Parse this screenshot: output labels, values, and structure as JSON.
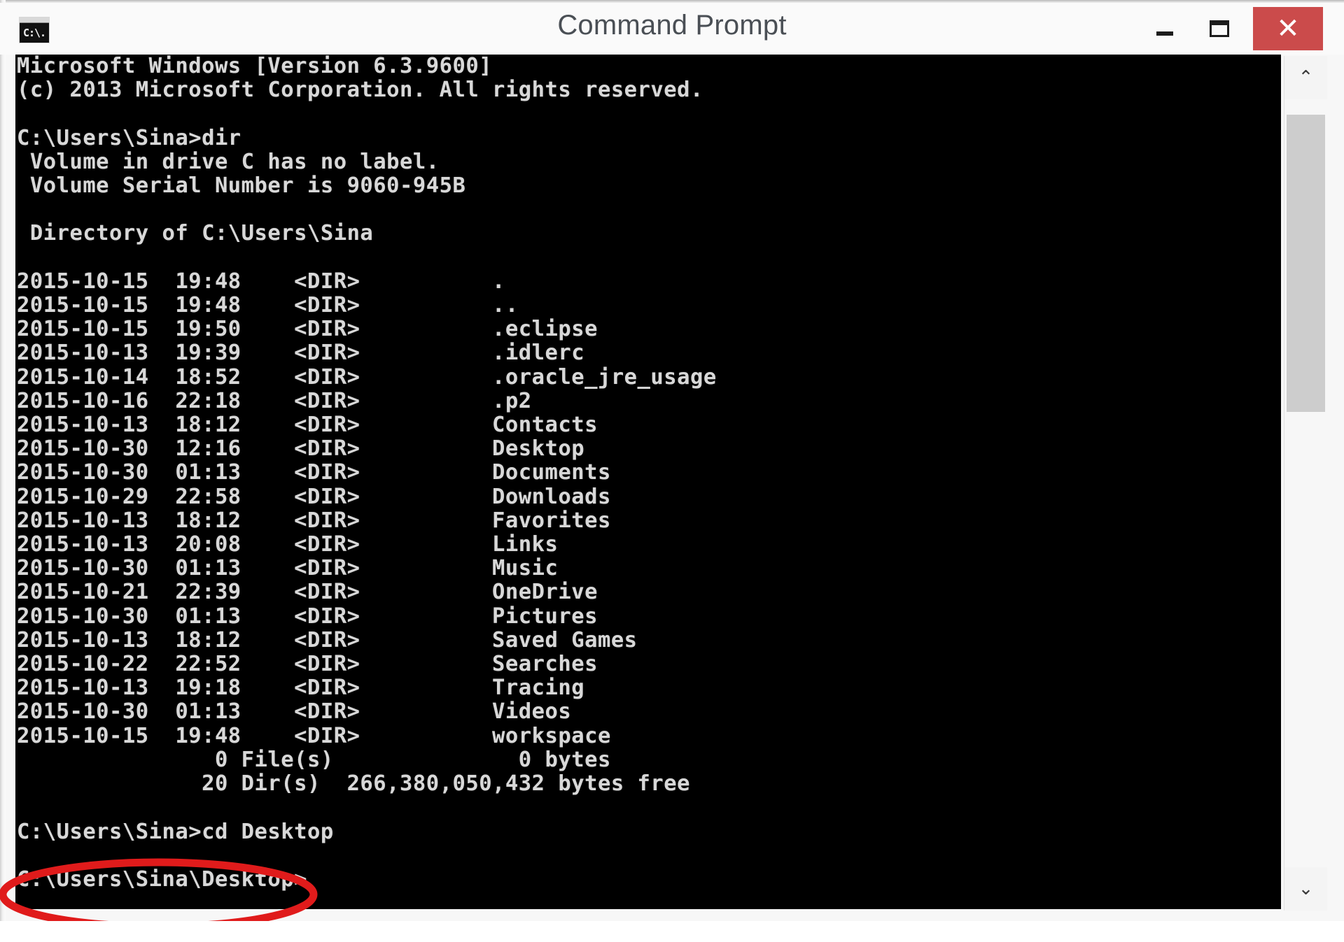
{
  "window": {
    "title": "Command Prompt",
    "app_icon_label": "C:\\.",
    "icon_name": "command-prompt-icon",
    "controls": {
      "minimize_label": "–",
      "maximize_label": "☐",
      "close_label": "✕"
    },
    "close_button_color": "#cb4b4b",
    "titlebar_background": "#fafafa"
  },
  "console": {
    "background": "#000000",
    "foreground": "#d8d8d8",
    "banner": [
      "Microsoft Windows [Version 6.3.9600]",
      "(c) 2013 Microsoft Corporation. All rights reserved."
    ],
    "prompt_dir": "C:\\Users\\Sina>",
    "command_1": "dir",
    "volume_lines": [
      " Volume in drive C has no label.",
      " Volume Serial Number is 9060-945B"
    ],
    "directory_header": " Directory of C:\\Users\\Sina",
    "listing_columns": [
      "date",
      "time",
      "type",
      "name"
    ],
    "listing": [
      {
        "date": "2015-10-15",
        "time": "19:48",
        "type": "<DIR>",
        "name": "."
      },
      {
        "date": "2015-10-15",
        "time": "19:48",
        "type": "<DIR>",
        "name": ".."
      },
      {
        "date": "2015-10-15",
        "time": "19:50",
        "type": "<DIR>",
        "name": ".eclipse"
      },
      {
        "date": "2015-10-13",
        "time": "19:39",
        "type": "<DIR>",
        "name": ".idlerc"
      },
      {
        "date": "2015-10-14",
        "time": "18:52",
        "type": "<DIR>",
        "name": ".oracle_jre_usage"
      },
      {
        "date": "2015-10-16",
        "time": "22:18",
        "type": "<DIR>",
        "name": ".p2"
      },
      {
        "date": "2015-10-13",
        "time": "18:12",
        "type": "<DIR>",
        "name": "Contacts"
      },
      {
        "date": "2015-10-30",
        "time": "12:16",
        "type": "<DIR>",
        "name": "Desktop"
      },
      {
        "date": "2015-10-30",
        "time": "01:13",
        "type": "<DIR>",
        "name": "Documents"
      },
      {
        "date": "2015-10-29",
        "time": "22:58",
        "type": "<DIR>",
        "name": "Downloads"
      },
      {
        "date": "2015-10-13",
        "time": "18:12",
        "type": "<DIR>",
        "name": "Favorites"
      },
      {
        "date": "2015-10-13",
        "time": "20:08",
        "type": "<DIR>",
        "name": "Links"
      },
      {
        "date": "2015-10-30",
        "time": "01:13",
        "type": "<DIR>",
        "name": "Music"
      },
      {
        "date": "2015-10-21",
        "time": "22:39",
        "type": "<DIR>",
        "name": "OneDrive"
      },
      {
        "date": "2015-10-30",
        "time": "01:13",
        "type": "<DIR>",
        "name": "Pictures"
      },
      {
        "date": "2015-10-13",
        "time": "18:12",
        "type": "<DIR>",
        "name": "Saved Games"
      },
      {
        "date": "2015-10-22",
        "time": "22:52",
        "type": "<DIR>",
        "name": "Searches"
      },
      {
        "date": "2015-10-13",
        "time": "19:18",
        "type": "<DIR>",
        "name": "Tracing"
      },
      {
        "date": "2015-10-30",
        "time": "01:13",
        "type": "<DIR>",
        "name": "Videos"
      },
      {
        "date": "2015-10-15",
        "time": "19:48",
        "type": "<DIR>",
        "name": "workspace"
      }
    ],
    "summary": {
      "file_count": "0",
      "file_label": "File(s)",
      "file_bytes": "0 bytes",
      "dir_count": "20",
      "dir_label": "Dir(s)",
      "free_bytes": "266,380,050,432 bytes free"
    },
    "command_2_prompt": "C:\\Users\\Sina>",
    "command_2": "cd Desktop",
    "final_prompt": "C:\\Users\\Sina\\Desktop>",
    "full_text": "Microsoft Windows [Version 6.3.9600]\n(c) 2013 Microsoft Corporation. All rights reserved.\n\nC:\\Users\\Sina>dir\n Volume in drive C has no label.\n Volume Serial Number is 9060-945B\n\n Directory of C:\\Users\\Sina\n\n2015-10-15  19:48    <DIR>          .\n2015-10-15  19:48    <DIR>          ..\n2015-10-15  19:50    <DIR>          .eclipse\n2015-10-13  19:39    <DIR>          .idlerc\n2015-10-14  18:52    <DIR>          .oracle_jre_usage\n2015-10-16  22:18    <DIR>          .p2\n2015-10-13  18:12    <DIR>          Contacts\n2015-10-30  12:16    <DIR>          Desktop\n2015-10-30  01:13    <DIR>          Documents\n2015-10-29  22:58    <DIR>          Downloads\n2015-10-13  18:12    <DIR>          Favorites\n2015-10-13  20:08    <DIR>          Links\n2015-10-30  01:13    <DIR>          Music\n2015-10-21  22:39    <DIR>          OneDrive\n2015-10-30  01:13    <DIR>          Pictures\n2015-10-13  18:12    <DIR>          Saved Games\n2015-10-22  22:52    <DIR>          Searches\n2015-10-13  19:18    <DIR>          Tracing\n2015-10-30  01:13    <DIR>          Videos\n2015-10-15  19:48    <DIR>          workspace\n               0 File(s)              0 bytes\n              20 Dir(s)  266,380,050,432 bytes free\n\nC:\\Users\\Sina>cd Desktop\n\nC:\\Users\\Sina\\Desktop>"
  },
  "scrollbar": {
    "up_arrow": "⌃",
    "down_arrow": "⌄",
    "thumb_position_percent": 2,
    "thumb_size_percent": 39
  },
  "annotation": {
    "shape": "ellipse",
    "color": "#e01b1b",
    "targets": "C:\\Users\\Sina\\Desktop>"
  }
}
